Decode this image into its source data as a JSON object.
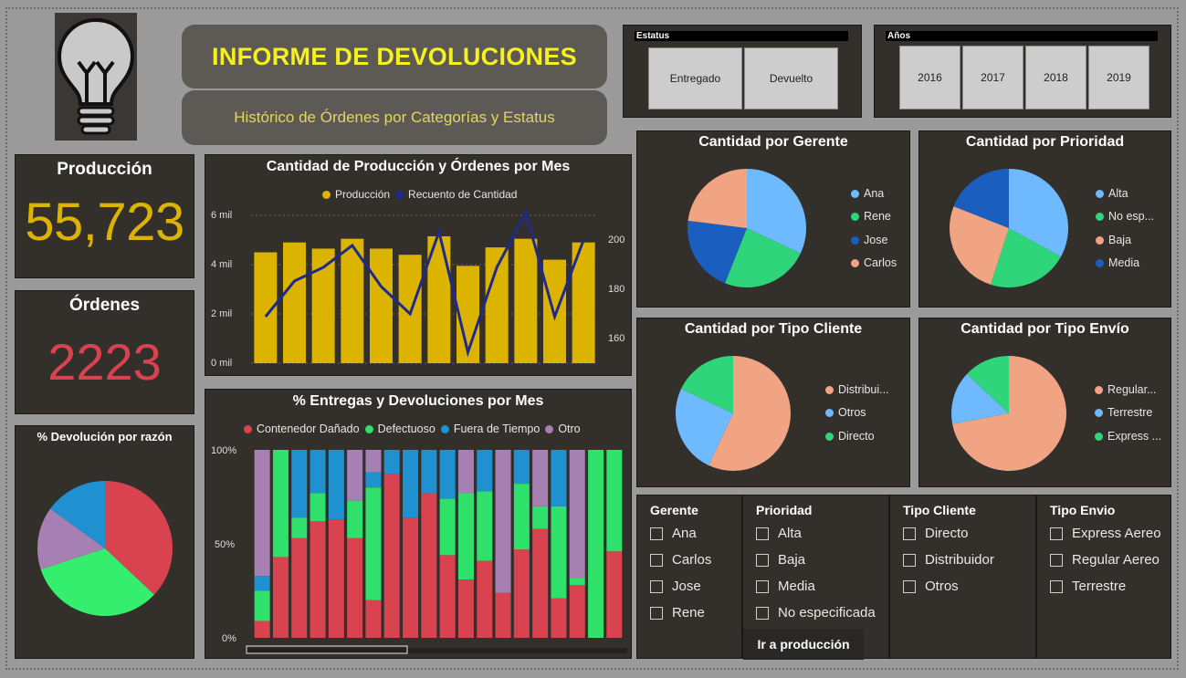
{
  "header": {
    "title": "INFORME DE DEVOLUCIONES",
    "subtitle": "Histórico de Órdenes por Categorías y Estatus"
  },
  "colors": {
    "bg": "#9a9a9a",
    "panel": "#33302c",
    "accent_yellow": "#f5f01e",
    "gold": "#dcb400",
    "red_kpi": "#d9424f",
    "navy": "#1f2a8a"
  },
  "slicers": {
    "estatus": {
      "label": "Estatus",
      "options": [
        "Entregado",
        "Devuelto"
      ]
    },
    "anios": {
      "label": "Años",
      "options": [
        "2016",
        "2017",
        "2018",
        "2019"
      ]
    }
  },
  "kpis": {
    "produccion": {
      "label": "Producción",
      "value": "55,723"
    },
    "ordenes": {
      "label": "Órdenes",
      "value": "2223"
    }
  },
  "charts": {
    "combo": {
      "title": "Cantidad de Producción y Órdenes por Mes",
      "legend": [
        "Producción",
        "Recuento de Cantidad"
      ],
      "y_left_ticks": [
        "6 mil",
        "4 mil",
        "2 mil",
        "0 mil"
      ],
      "y_right_ticks": [
        "200",
        "180",
        "160"
      ]
    },
    "stacked": {
      "title": "% Entregas y Devoluciones por Mes",
      "legend": [
        "Contenedor Dañado",
        "Defectuoso",
        "Fuera de Tiempo",
        "Otro"
      ],
      "y_ticks": [
        "100%",
        "50%",
        "0%"
      ]
    },
    "razon": {
      "title": "% Devolución por razón"
    },
    "gerente": {
      "title": "Cantidad por Gerente",
      "legend": [
        "Ana",
        "Rene",
        "Jose",
        "Carlos"
      ]
    },
    "prioridad": {
      "title": "Cantidad por Prioridad",
      "legend": [
        "Alta",
        "No esp...",
        "Baja",
        "Media"
      ]
    },
    "tipo_cliente": {
      "title": "Cantidad por Tipo Cliente",
      "legend": [
        "Distribui...",
        "Otros",
        "Directo"
      ]
    },
    "tipo_envio": {
      "title": "Cantidad por Tipo Envío",
      "legend": [
        "Regular...",
        "Terrestre",
        "Express ..."
      ]
    }
  },
  "chart_data": [
    {
      "type": "bar",
      "id": "combo",
      "title": "Cantidad de Producción y Órdenes por Mes",
      "categories": [
        "",
        "",
        "",
        "",
        "",
        "",
        "",
        "",
        "",
        "",
        "",
        ""
      ],
      "series": [
        {
          "name": "Producción",
          "axis": "left",
          "kind": "bar",
          "color": "#dcb400",
          "values": [
            4500,
            4900,
            4650,
            5050,
            4650,
            4400,
            5150,
            3950,
            4700,
            5050,
            4200,
            4900
          ]
        },
        {
          "name": "Recuento de Cantidad",
          "axis": "right",
          "kind": "line",
          "color": "#1f2a8a",
          "values": [
            171,
            184,
            189,
            197,
            182,
            172,
            202,
            158,
            189,
            209,
            171,
            199
          ]
        }
      ],
      "ylim_left": [
        0,
        6000
      ],
      "ylim_right": [
        154,
        208
      ],
      "grid": true,
      "legend_position": "top"
    },
    {
      "type": "bar",
      "id": "stacked",
      "title": "% Entregas y Devoluciones por Mes",
      "stacked": true,
      "percent": true,
      "categories": [
        "",
        "",
        "",
        "",
        "",
        "",
        "",
        "",
        "",
        "",
        "",
        "",
        "",
        "",
        "",
        "",
        "",
        "",
        "",
        ""
      ],
      "series": [
        {
          "name": "Contenedor Dañado",
          "color": "#d9424f",
          "values": [
            9,
            43,
            53,
            62,
            63,
            53,
            20,
            87,
            64,
            77,
            44,
            31,
            41,
            24,
            47,
            58,
            21,
            28,
            0,
            46
          ]
        },
        {
          "name": "Defectuoso",
          "color": "#2fe06a",
          "values": [
            16,
            57,
            11,
            15,
            0,
            20,
            60,
            0,
            0,
            0,
            30,
            46,
            37,
            0,
            35,
            12,
            49,
            4,
            100,
            54
          ]
        },
        {
          "name": "Fuera de Tiempo",
          "color": "#1f90d0",
          "values": [
            8,
            0,
            36,
            23,
            37,
            0,
            8,
            13,
            36,
            23,
            26,
            0,
            22,
            0,
            18,
            0,
            30,
            0,
            0,
            0
          ]
        },
        {
          "name": "Otro",
          "color": "#a67fb3",
          "values": [
            67,
            0,
            0,
            0,
            0,
            27,
            12,
            0,
            0,
            0,
            0,
            23,
            0,
            76,
            0,
            30,
            0,
            68,
            0,
            0
          ]
        }
      ],
      "ylim": [
        0,
        100
      ],
      "legend_position": "top"
    },
    {
      "type": "pie",
      "id": "razon",
      "title": "% Devolución por razón",
      "labels": [
        "Contenedor Dañado",
        "Defectuoso",
        "Otro",
        "Fuera de Tiempo"
      ],
      "values": [
        37,
        33,
        15,
        15
      ],
      "colors": [
        "#d9424f",
        "#35ee6e",
        "#a67fb3",
        "#1f90d0"
      ]
    },
    {
      "type": "pie",
      "id": "gerente",
      "title": "Cantidad por Gerente",
      "labels": [
        "Ana",
        "Rene",
        "Jose",
        "Carlos"
      ],
      "values": [
        32,
        24,
        21,
        23
      ],
      "colors": [
        "#6fb9ff",
        "#2ed57a",
        "#1a5fbf",
        "#f0a484"
      ]
    },
    {
      "type": "pie",
      "id": "prioridad",
      "title": "Cantidad por Prioridad",
      "labels": [
        "Alta",
        "No esp...",
        "Baja",
        "Media"
      ],
      "values": [
        33,
        22,
        26,
        19
      ],
      "colors": [
        "#6fb9ff",
        "#2ed57a",
        "#f0a484",
        "#1a5fbf"
      ]
    },
    {
      "type": "pie",
      "id": "tipo_cliente",
      "title": "Cantidad por Tipo Cliente",
      "labels": [
        "Distribui...",
        "Otros",
        "Directo"
      ],
      "values": [
        57,
        25,
        18
      ],
      "colors": [
        "#f0a484",
        "#6fb9ff",
        "#2ed57a"
      ]
    },
    {
      "type": "pie",
      "id": "tipo_envio",
      "title": "Cantidad por Tipo Envío",
      "labels": [
        "Regular...",
        "Terrestre",
        "Express ..."
      ],
      "values": [
        72,
        15,
        13
      ],
      "colors": [
        "#f0a484",
        "#6fb9ff",
        "#2ed57a"
      ]
    }
  ],
  "filters": {
    "gerente": {
      "title": "Gerente",
      "items": [
        "Ana",
        "Carlos",
        "Jose",
        "Rene"
      ]
    },
    "prioridad": {
      "title": "Prioridad",
      "items": [
        "Alta",
        "Baja",
        "Media",
        "No especificada"
      ]
    },
    "tipo_cliente": {
      "title": "Tipo Cliente",
      "items": [
        "Directo",
        "Distribuidor",
        "Otros"
      ]
    },
    "tipo_envio": {
      "title": "Tipo Envio",
      "items": [
        "Express Aereo",
        "Regular Aereo",
        "Terrestre"
      ]
    },
    "button_label": "Ir a producción"
  }
}
